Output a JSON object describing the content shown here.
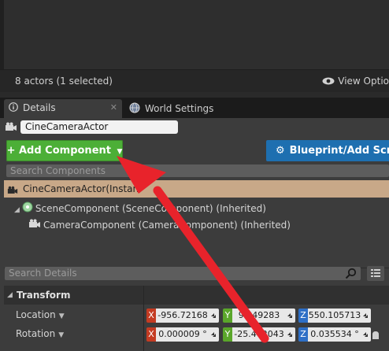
{
  "outliner": {
    "actor_count": "8 actors (1 selected)",
    "view_options": "View Optio"
  },
  "tabs": [
    {
      "label": "Details"
    },
    {
      "label": "World Settings"
    }
  ],
  "details": {
    "actor_name": "CineCameraActor",
    "add_component_label": "+ Add Component",
    "blueprint_label": "Blueprint/Add Scri",
    "search_components_placeholder": "Search Components",
    "selected_actor_row": "CineCameraActor(Instan",
    "components": [
      {
        "label": "SceneComponent (SceneComponent) (Inherited)"
      },
      {
        "label": "CameraComponent (CameraComponent) (Inherited)"
      }
    ],
    "search_details_placeholder": "Search Details"
  },
  "transform": {
    "header": "Transform",
    "location": {
      "label": "Location",
      "x": "-956.72168",
      "y": "9.849283",
      "z": "550.105713"
    },
    "rotation": {
      "label": "Rotation",
      "x": "0.000009 °",
      "y": "-25.442043",
      "z": "0.035534 °"
    }
  },
  "colors": {
    "add_component": "#4caf37",
    "blueprint": "#1e6fb0",
    "selected_row": "#c8a888",
    "annotation_arrow": "#e8232b"
  }
}
